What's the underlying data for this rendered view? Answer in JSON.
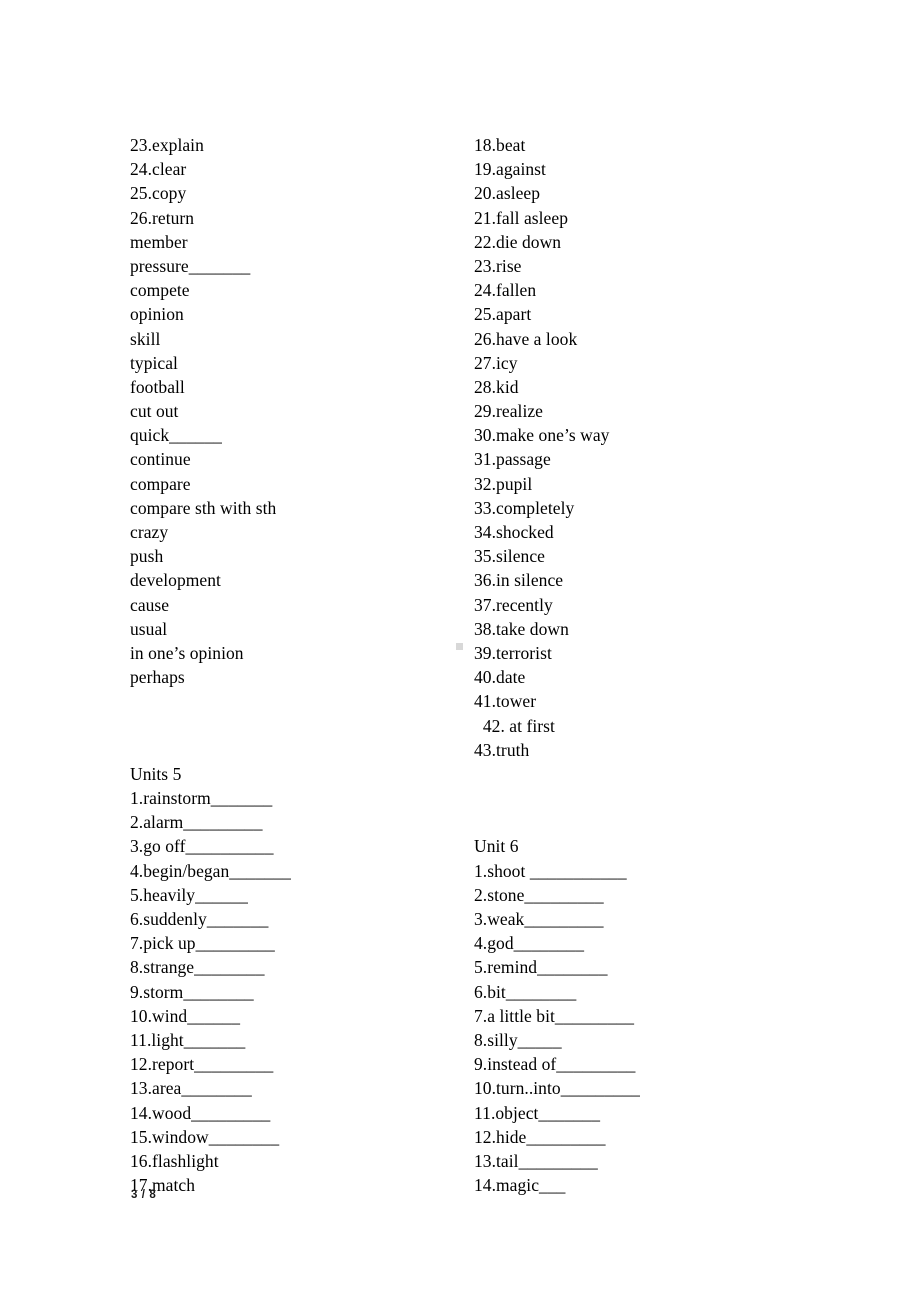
{
  "document": {
    "page_indicator": "3 / 8",
    "background_color": "#ffffff",
    "text_color": "#000000"
  },
  "left_column": {
    "blocks": [
      {
        "heading": null,
        "items": [
          "23.explain",
          "24.clear",
          "25.copy",
          "26.return",
          "member",
          "pressure_______",
          "compete",
          "opinion",
          "skill",
          "typical",
          "football",
          "cut out",
          "quick______",
          "continue",
          "compare",
          "compare sth with sth",
          "crazy",
          "push",
          "development",
          "cause",
          "usual",
          "in one’s opinion",
          "perhaps"
        ]
      },
      {
        "heading": "Units 5",
        "items": [
          "1.rainstorm_______",
          "2.alarm_________",
          "3.go off__________",
          "4.begin/began_______",
          "5.heavily______",
          "6.suddenly_______",
          "7.pick up_________",
          "8.strange________",
          "9.storm________",
          "10.wind______",
          "11.light_______",
          "12.report_________",
          "13.area________",
          "14.wood_________",
          "15.window________",
          "16.flashlight",
          "17.match"
        ]
      }
    ]
  },
  "right_column": {
    "blocks": [
      {
        "heading": null,
        "items": [
          "18.beat",
          "19.against",
          "20.asleep",
          "21.fall asleep",
          "22.die down",
          "23.rise",
          "24.fallen",
          "25.apart",
          "26.have a look",
          "27.icy",
          "28.kid",
          "29.realize",
          "30.make one’s way",
          "31.passage",
          "32.pupil",
          "33.completely",
          "34.shocked",
          "35.silence",
          "36.in silence",
          "37.recently",
          "38.take down",
          "39.terrorist",
          "40.date",
          "41.tower",
          "  42. at first",
          "43.truth"
        ]
      },
      {
        "heading": "Unit 6",
        "items": [
          "1.shoot ___________",
          "2.stone_________",
          "3.weak_________",
          "4.god________",
          "5.remind________",
          "6.bit________",
          "7.a little bit_________",
          "8.silly_____",
          "9.instead of_________",
          "10.turn..into_________",
          "11.object_______",
          "12.hide_________",
          "13.tail_________",
          "14.magic___"
        ]
      }
    ]
  }
}
